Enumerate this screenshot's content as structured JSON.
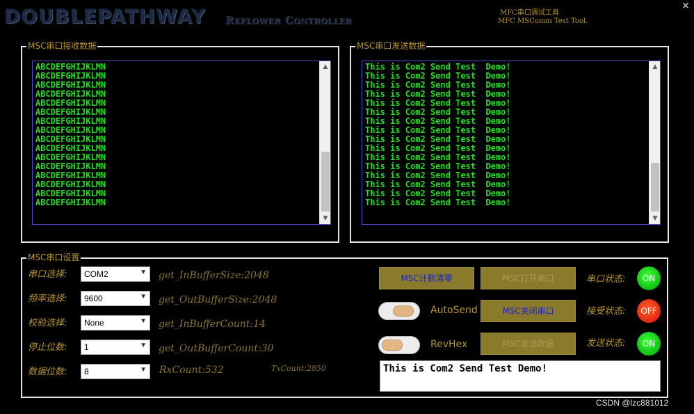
{
  "title": {
    "brand": "DOUBLEPATHWAY",
    "subtitle": "Reflower Controller",
    "info_line1": "MFC串口调试工具",
    "info_line2": "MFC MSComm Test Tool.",
    "close_label": "✕"
  },
  "receive": {
    "group_title": "MSC串口接收数据",
    "lines": [
      "ABCDEFGHIJKLMN",
      "ABCDEFGHIJKLMN",
      "ABCDEFGHIJKLMN",
      "ABCDEFGHIJKLMN",
      "ABCDEFGHIJKLMN",
      "ABCDEFGHIJKLMN",
      "ABCDEFGHIJKLMN",
      "ABCDEFGHIJKLMN",
      "ABCDEFGHIJKLMN",
      "ABCDEFGHIJKLMN",
      "ABCDEFGHIJKLMN",
      "ABCDEFGHIJKLMN",
      "ABCDEFGHIJKLMN",
      "ABCDEFGHIJKLMN",
      "ABCDEFGHIJKLMN",
      "ABCDEFGHIJKLMN"
    ]
  },
  "send": {
    "group_title": "MSC串口发送数据",
    "lines": [
      "This is Com2 Send Test  Demo!",
      "This is Com2 Send Test  Demo!",
      "This is Com2 Send Test  Demo!",
      "This is Com2 Send Test  Demo!",
      "This is Com2 Send Test  Demo!",
      "This is Com2 Send Test  Demo!",
      "This is Com2 Send Test  Demo!",
      "This is Com2 Send Test  Demo!",
      "This is Com2 Send Test  Demo!",
      "This is Com2 Send Test  Demo!",
      "This is Com2 Send Test  Demo!",
      "This is Com2 Send Test  Demo!",
      "This is Com2 Send Test  Demo!",
      "This is Com2 Send Test  Demo!",
      "This is Com2 Send Test  Demo!",
      "This is Com2 Send Test  Demo!"
    ]
  },
  "settings": {
    "group_title": "MSC串口设置",
    "port_label": "串口选择:",
    "port_value": "COM2",
    "baud_label": "频率选择:",
    "baud_value": "9600",
    "parity_label": "校验选择:",
    "parity_value": "None",
    "stop_label": "停止位数:",
    "stop_value": "1",
    "data_label": "数据位数:",
    "data_value": "8",
    "in_buffer_size": "get_InBufferSize:2048",
    "out_buffer_size": "get_OutBufferSize:2048",
    "in_buffer_count": "get_InBufferCount:14",
    "out_buffer_count": "get_OutBufferCount:30",
    "rx_count": "RxCount:532",
    "tx_count": "TxCount:2850"
  },
  "controls": {
    "clear_count_label": "MSC计数清零",
    "open_port_label": "MSC打开串口",
    "close_port_label": "MSC关闭串口",
    "send_data_label": "MSC发送数据",
    "autosend_label": "AutoSend",
    "revhex_label": "RevHex",
    "port_status_label": "串口状态:",
    "recv_status_label": "接受状态:",
    "send_status_label": "发送状态:",
    "port_status_value": "ON",
    "recv_status_value": "OFF",
    "send_status_value": "ON",
    "send_text": "This is Com2 Send Test  Demo!"
  },
  "watermark": "CSDN @lzc881012",
  "colors": {
    "background": "#000000",
    "label_gold": "#b8962e",
    "terminal_green": "#22dd22",
    "button_olive": "#8a7a2c",
    "led_on": "#10c010",
    "led_off": "#e02a10"
  }
}
